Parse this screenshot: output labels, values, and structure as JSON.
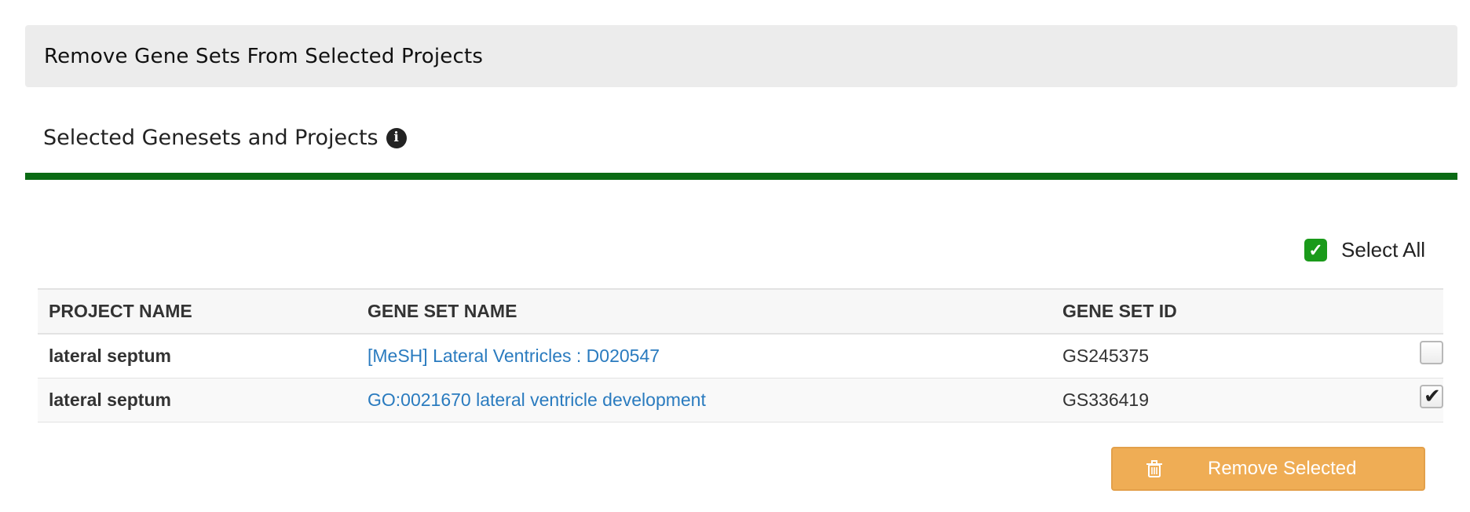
{
  "panel": {
    "title": "Remove Gene Sets From Selected Projects"
  },
  "section": {
    "title": "Selected Genesets and Projects",
    "info_icon": "info-circle-icon"
  },
  "select_all": {
    "label": "Select All",
    "checked": true
  },
  "table": {
    "columns": [
      "PROJECT NAME",
      "GENE SET NAME",
      "GENE SET ID"
    ],
    "rows": [
      {
        "project": "lateral septum",
        "gene_set_name": "[MeSH] Lateral Ventricles : D020547",
        "gene_set_id": "GS245375",
        "checked": false
      },
      {
        "project": "lateral septum",
        "gene_set_name": "GO:0021670 lateral ventricle development",
        "gene_set_id": "GS336419",
        "checked": true
      }
    ]
  },
  "actions": {
    "remove_label": "Remove Selected",
    "remove_icon": "trash-icon"
  },
  "colors": {
    "accent_green": "#0b6b15",
    "button_orange": "#efad55",
    "link_blue": "#2a7bbf"
  }
}
